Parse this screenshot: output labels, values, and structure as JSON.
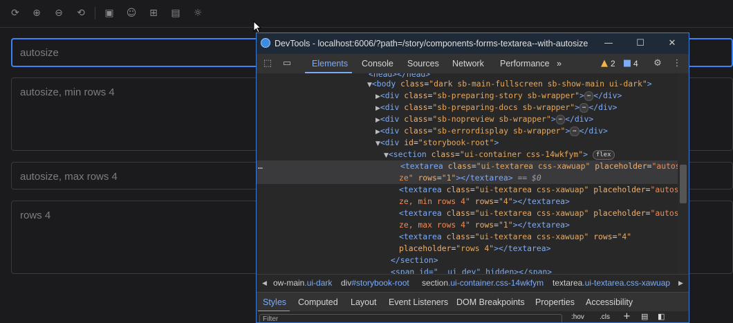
{
  "toolbar": {
    "icons": [
      "reload-icon",
      "zoom-in-icon",
      "zoom-out-icon",
      "reset-zoom-icon",
      "outline-icon",
      "accessibility-icon",
      "grid-icon",
      "measure-icon",
      "theme-icon"
    ]
  },
  "story": {
    "textareas": [
      {
        "placeholder": "autosize"
      },
      {
        "placeholder": "autosize, min rows 4"
      },
      {
        "placeholder": "autosize, max rows 4"
      },
      {
        "placeholder": "rows 4"
      }
    ]
  },
  "devtools": {
    "title": "DevTools - localhost:6006/?path=/story/components-forms-textarea--with-autosize",
    "tabs": [
      "Elements",
      "Console",
      "Sources",
      "Network",
      "Performance"
    ],
    "more_tabs": "»",
    "warnings": "2",
    "messages": "4",
    "code": {
      "l0": "<head></head>",
      "l1_tag": "<body",
      "l1_attr": "class",
      "l1_val": "\"dark sb-main-fullscreen sb-show-main ui-dark\"",
      "l2": "\"sb-preparing-story sb-wrapper\"",
      "l3": "\"sb-preparing-docs sb-wrapper\"",
      "l4": "\"sb-nopreview sb-wrapper\"",
      "l5": "\"sb-errordisplay sb-wrapper\"",
      "l6": "\"storybook-root\"",
      "l7": "\"ui-container css-14wkfym\"",
      "flex": "flex",
      "ta_class": "\"ui-textarea css-xawuap\"",
      "l8a": "\"autosi",
      "l8b": "ze\"",
      "rows1": "\"1\"",
      "rows4": "\"4\"",
      "l10b": "ze, min rows 4\"",
      "l12b": "ze, max rows 4\"",
      "l15": "\"rows 4\"",
      "eq": "== $0",
      "section_end": "</section>",
      "span_line": "<span id=\"__ui_dev\" hidden></span>"
    },
    "breadcrumbs": [
      {
        "tag": "ow-main",
        "cls": ".ui-dark"
      },
      {
        "tag": "div",
        "cls": "#storybook-root"
      },
      {
        "tag": "section",
        "cls": ".ui-container.css-14wkfym"
      },
      {
        "tag": "textarea",
        "cls": ".ui-textarea.css-xawuap"
      }
    ],
    "sub_tabs": [
      "Styles",
      "Computed",
      "Layout",
      "Event Listeners",
      "DOM Breakpoints",
      "Properties",
      "Accessibility"
    ],
    "filter_placeholder": "Filter",
    "hov": ":hov",
    "cls": ".cls"
  }
}
